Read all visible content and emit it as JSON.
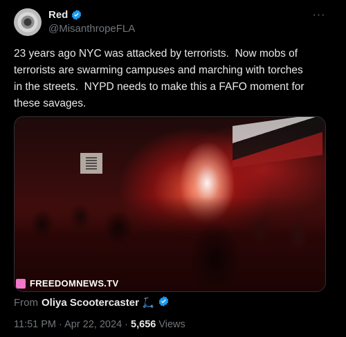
{
  "author": {
    "display_name": "Red",
    "handle": "@MisanthropeFLA",
    "verified": true
  },
  "more_icon": "···",
  "tweet_text": "23 years ago NYC was attacked by terrorists.  Now mobs of\nterrorists are swarming campuses and marching with torches\nin the streets.  NYPD needs to make this a FAFO moment for\nthese savages.",
  "media": {
    "watermark": "FREEDOMNEWS.TV"
  },
  "attribution": {
    "from_label": "From",
    "user": "Oliya Scootercaster",
    "emoji": "🛴",
    "verified": true
  },
  "meta": {
    "time": "11:51 PM",
    "separator1": " · ",
    "date": "Apr 22, 2024",
    "separator2": " · ",
    "views_count": "5,656",
    "views_label": " Views"
  },
  "colors": {
    "background": "#000000",
    "text": "#e7e9ea",
    "muted": "#71767b",
    "verified_blue": "#1d9bf0"
  }
}
